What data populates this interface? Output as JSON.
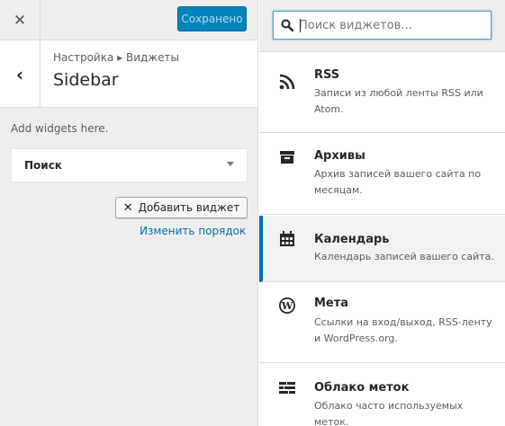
{
  "header": {
    "close_symbol": "✕",
    "save_label": "Сохранено"
  },
  "section": {
    "back_symbol": "‹",
    "breadcrumb": "Настройка ▸ Виджеты",
    "title": "Sidebar"
  },
  "sidebar_area": {
    "hint": "Add widgets here.",
    "widgets": [
      {
        "title": "Поиск"
      }
    ],
    "add_button_icon": "✕",
    "add_button_label": "Добавить виджет",
    "reorder_link": "Изменить порядок"
  },
  "available": {
    "search_placeholder": "Поиск виджетов...",
    "items": [
      {
        "name": "RSS",
        "desc": "Записи из любой ленты RSS или Atom.",
        "icon": "rss-icon",
        "active": false
      },
      {
        "name": "Архивы",
        "desc": "Архив записей вашего сайта по месяцам.",
        "icon": "archive-icon",
        "active": false
      },
      {
        "name": "Календарь",
        "desc": "Календарь записей вашего сайта.",
        "icon": "calendar-icon",
        "active": true
      },
      {
        "name": "Мета",
        "desc": "Ссылки на вход/выход, RSS-ленту и WordPress.org.",
        "icon": "wordpress-icon",
        "active": false
      },
      {
        "name": "Облако меток",
        "desc": "Облако часто используемых меток.",
        "icon": "tag-cloud-icon",
        "active": false
      }
    ]
  },
  "colors": {
    "accent": "#0073aa",
    "save_bg": "#0085ba",
    "panel_bg": "#eeeeee"
  }
}
